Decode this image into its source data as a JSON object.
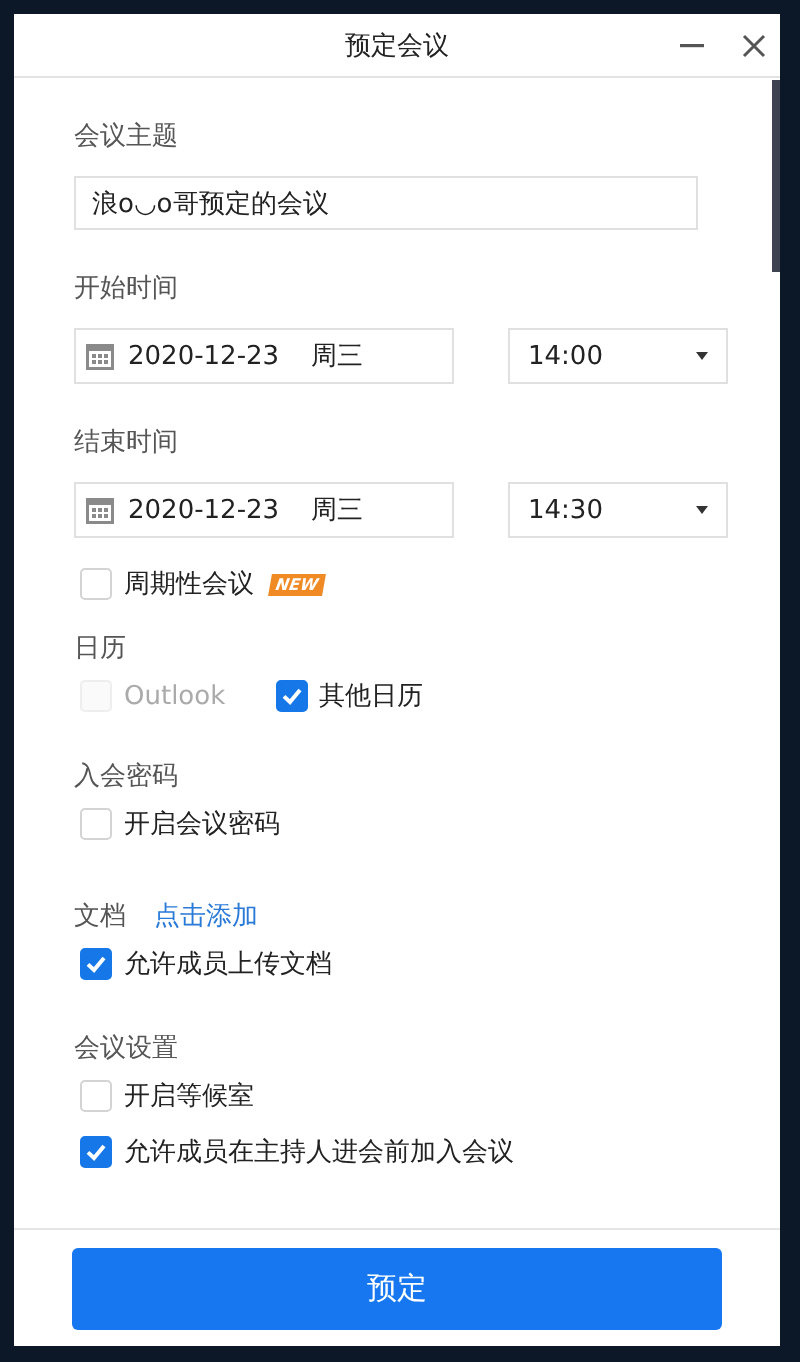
{
  "window": {
    "title": "预定会议"
  },
  "subject": {
    "label": "会议主题",
    "value": "浪o◡o哥预定的会议"
  },
  "times": [
    {
      "label": "开始时间",
      "date": "2020-12-23",
      "weekday": "周三",
      "time": "14:00"
    },
    {
      "label": "结束时间",
      "date": "2020-12-23",
      "weekday": "周三",
      "time": "14:30"
    }
  ],
  "recurring": {
    "label": "周期性会议",
    "checked": false,
    "badge": "NEW"
  },
  "sections": [
    {
      "label": "日历",
      "options": [
        {
          "label": "Outlook",
          "checked": false,
          "disabled": true
        },
        {
          "label": "其他日历",
          "checked": true,
          "disabled": false
        }
      ]
    },
    {
      "label": "入会密码",
      "options": [
        {
          "label": "开启会议密码",
          "checked": false,
          "disabled": false
        }
      ]
    },
    {
      "label": "文档",
      "link": "点击添加",
      "options": [
        {
          "label": "允许成员上传文档",
          "checked": true,
          "disabled": false
        }
      ]
    },
    {
      "label": "会议设置",
      "options": [
        {
          "label": "开启等候室",
          "checked": false,
          "disabled": false
        },
        {
          "label": "允许成员在主持人进会前加入会议",
          "checked": true,
          "disabled": false
        }
      ]
    }
  ],
  "book_button": "预定"
}
